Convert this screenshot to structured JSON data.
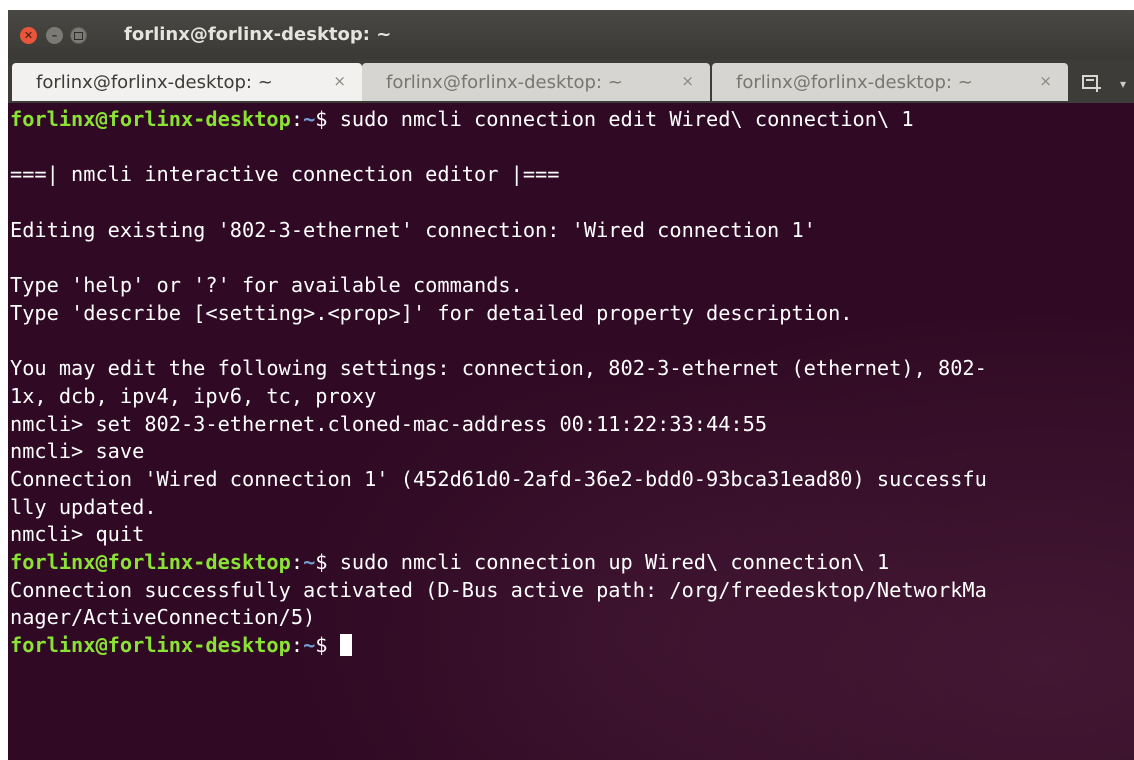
{
  "window": {
    "title": "forlinx@forlinx-desktop: ~"
  },
  "tabs": [
    {
      "label": "forlinx@forlinx-desktop: ~",
      "close": "×",
      "active": true
    },
    {
      "label": "forlinx@forlinx-desktop: ~",
      "close": "×",
      "active": false
    },
    {
      "label": "forlinx@forlinx-desktop: ~",
      "close": "×",
      "active": false
    }
  ],
  "colors": {
    "terminal_bg": "#300a24",
    "prompt_user": "#8ae234",
    "prompt_path": "#729fcf",
    "text": "#ffffff"
  },
  "terminal": {
    "prompt": {
      "user": "forlinx@forlinx-desktop",
      "sep": ":",
      "path": "~",
      "symbol": "$ "
    },
    "lines": [
      {
        "type": "cmd",
        "text": "sudo nmcli connection edit Wired\\ connection\\ 1"
      },
      {
        "type": "out",
        "text": ""
      },
      {
        "type": "out",
        "text": "===| nmcli interactive connection editor |==="
      },
      {
        "type": "out",
        "text": ""
      },
      {
        "type": "out",
        "text": "Editing existing '802-3-ethernet' connection: 'Wired connection 1'"
      },
      {
        "type": "out",
        "text": ""
      },
      {
        "type": "out",
        "text": "Type 'help' or '?' for available commands."
      },
      {
        "type": "out",
        "text": "Type 'describe [<setting>.<prop>]' for detailed property description."
      },
      {
        "type": "out",
        "text": ""
      },
      {
        "type": "out",
        "text": "You may edit the following settings: connection, 802-3-ethernet (ethernet), 802-"
      },
      {
        "type": "out",
        "text": "1x, dcb, ipv4, ipv6, tc, proxy"
      },
      {
        "type": "out",
        "text": "nmcli> set 802-3-ethernet.cloned-mac-address 00:11:22:33:44:55"
      },
      {
        "type": "out",
        "text": "nmcli> save"
      },
      {
        "type": "out",
        "text": "Connection 'Wired connection 1' (452d61d0-2afd-36e2-bdd0-93bca31ead80) successfu"
      },
      {
        "type": "out",
        "text": "lly updated."
      },
      {
        "type": "out",
        "text": "nmcli> quit"
      },
      {
        "type": "cmd",
        "text": "sudo nmcli connection up Wired\\ connection\\ 1"
      },
      {
        "type": "out",
        "text": "Connection successfully activated (D-Bus active path: /org/freedesktop/NetworkMa"
      },
      {
        "type": "out",
        "text": "nager/ActiveConnection/5)"
      },
      {
        "type": "cursor",
        "text": ""
      }
    ]
  }
}
